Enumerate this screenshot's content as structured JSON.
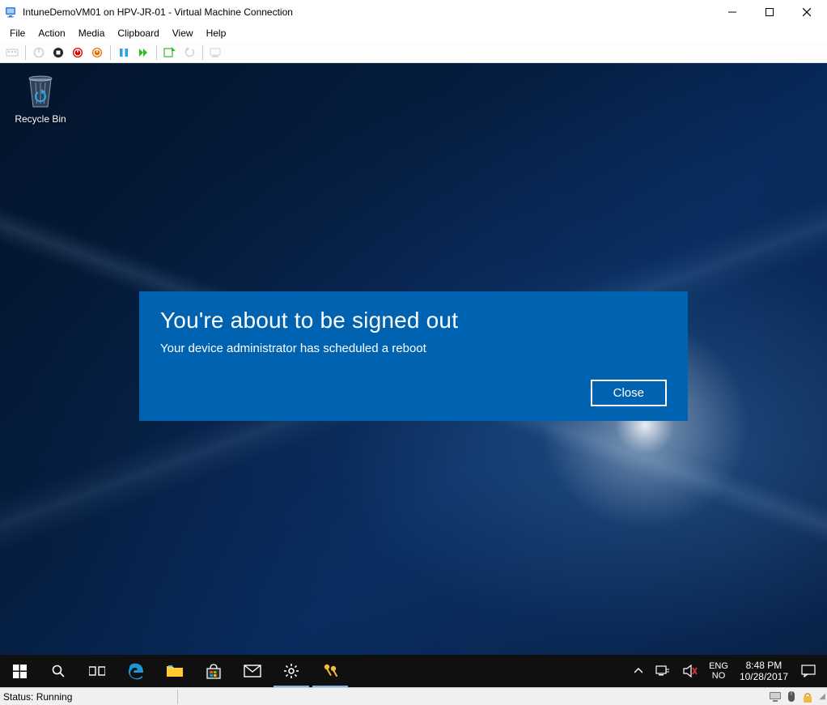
{
  "window": {
    "title": "IntuneDemoVM01 on HPV-JR-01 - Virtual Machine Connection"
  },
  "menu": {
    "items": [
      "File",
      "Action",
      "Media",
      "Clipboard",
      "View",
      "Help"
    ]
  },
  "toolbar": {
    "ctrl_alt_del": "ctrl-alt-del",
    "turn_off": "turn-off",
    "shut_down": "shut-down",
    "save": "save",
    "revert": "power",
    "pause": "pause",
    "start": "start",
    "checkpoint": "checkpoint",
    "undo": "revert",
    "share": "enhanced-session"
  },
  "desktop": {
    "recycle_bin": "Recycle Bin"
  },
  "notification": {
    "title": "You're about to be signed out",
    "message": "Your device administrator has scheduled a reboot",
    "close_label": "Close"
  },
  "taskbar": {
    "lang_top": "ENG",
    "lang_bottom": "NO",
    "time": "8:48 PM",
    "date": "10/28/2017"
  },
  "statusbar": {
    "text": "Status: Running"
  }
}
